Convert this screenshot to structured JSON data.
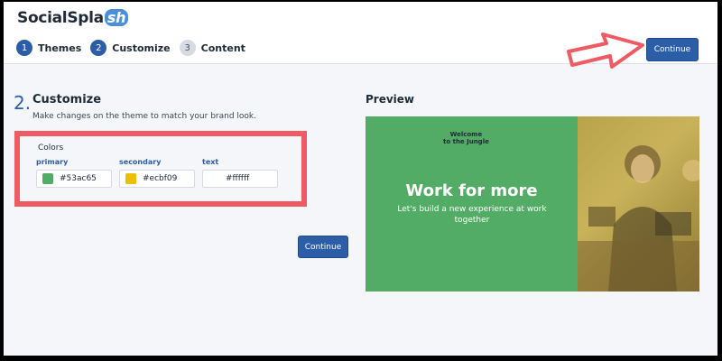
{
  "app": {
    "logo_text": "SocialSpla",
    "logo_badge": "sh"
  },
  "steps": [
    {
      "num": "1",
      "label": "Themes"
    },
    {
      "num": "2",
      "label": "Customize"
    },
    {
      "num": "3",
      "label": "Content"
    }
  ],
  "header": {
    "continue_label": "Continue"
  },
  "customize": {
    "section_num": "2.",
    "title": "Customize",
    "subtitle": "Make changes on the theme to match your brand look.",
    "colors_title": "Colors",
    "swatches": [
      {
        "label": "primary",
        "value": "#53ac65",
        "color": "#53ac65"
      },
      {
        "label": "secondary",
        "value": "#ecbf09",
        "color": "#ecbf09"
      },
      {
        "label": "text",
        "value": "#ffffff",
        "color": "#ffffff"
      }
    ],
    "continue_label": "Continue"
  },
  "preview": {
    "title": "Preview",
    "brand_line1": "Welcome",
    "brand_line2": "to the Jungle",
    "headline": "Work for more",
    "subline": "Let's build a new experience at work together"
  },
  "colors": {
    "accent": "#2c5ea8",
    "highlight": "#ef5a63"
  }
}
